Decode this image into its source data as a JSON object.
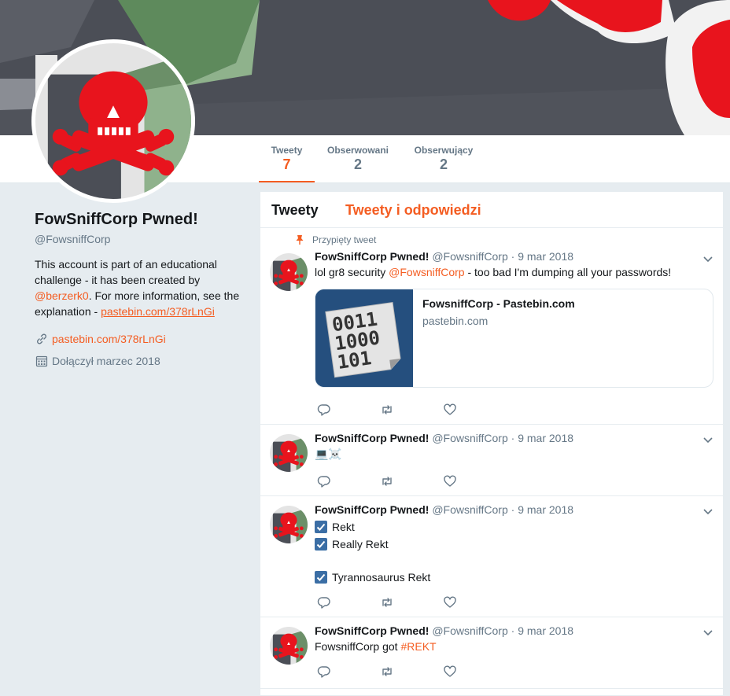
{
  "profile": {
    "name": "FowSniffCorp Pwned!",
    "handle": "@FowsniffCorp",
    "bio_part1": "This account is part of an educational challenge - it has been created by ",
    "bio_mention": "@berzerk0",
    "bio_part2": ". For more information, see the explanation - ",
    "bio_link": "pastebin.com/378rLnGi",
    "website": "pastebin.com/378rLnGi",
    "joined": "Dołączył marzec 2018"
  },
  "nav": {
    "items": [
      {
        "label": "Tweety",
        "value": "7"
      },
      {
        "label": "Obserwowani",
        "value": "2"
      },
      {
        "label": "Obserwujący",
        "value": "2"
      }
    ]
  },
  "timeline": {
    "tabs": [
      "Tweety",
      "Tweety i odpowiedzi"
    ],
    "pinned_label": "Przypięty tweet",
    "tweets": [
      {
        "name": "FowSniffCorp Pwned!",
        "handle": "@FowsniffCorp",
        "date": "· 9 mar 2018",
        "text_before": "lol gr8 security ",
        "text_mention": "@FowsniffCorp",
        "text_after": " - too bad I'm dumping all your passwords!",
        "card": {
          "title": "FowsniffCorp - Pastebin.com",
          "domain": "pastebin.com",
          "thumb_lines": [
            "0011",
            "1000",
            "101"
          ]
        }
      },
      {
        "name": "FowSniffCorp Pwned!",
        "handle": "@FowsniffCorp",
        "date": "· 9 mar 2018",
        "text": "💻☠️"
      },
      {
        "name": "FowSniffCorp Pwned!",
        "handle": "@FowsniffCorp",
        "date": "· 9 mar 2018",
        "lines": [
          "Rekt",
          "Really Rekt",
          "Tyrannosaurus Rekt"
        ]
      },
      {
        "name": "FowSniffCorp Pwned!",
        "handle": "@FowsniffCorp",
        "date": "· 9 mar 2018",
        "text_before": "FowsniffCorp got ",
        "hashtag": "#REKT"
      }
    ]
  },
  "colors": {
    "accent": "#f45d22",
    "banner": "#4a4d55",
    "skull_red": "#e8141d",
    "page_bg": "#e6ecf0"
  },
  "icons": [
    "reply-icon",
    "retweet-icon",
    "like-icon",
    "caret-down-icon",
    "pin-icon",
    "link-icon",
    "calendar-icon",
    "checkbox-icon"
  ]
}
